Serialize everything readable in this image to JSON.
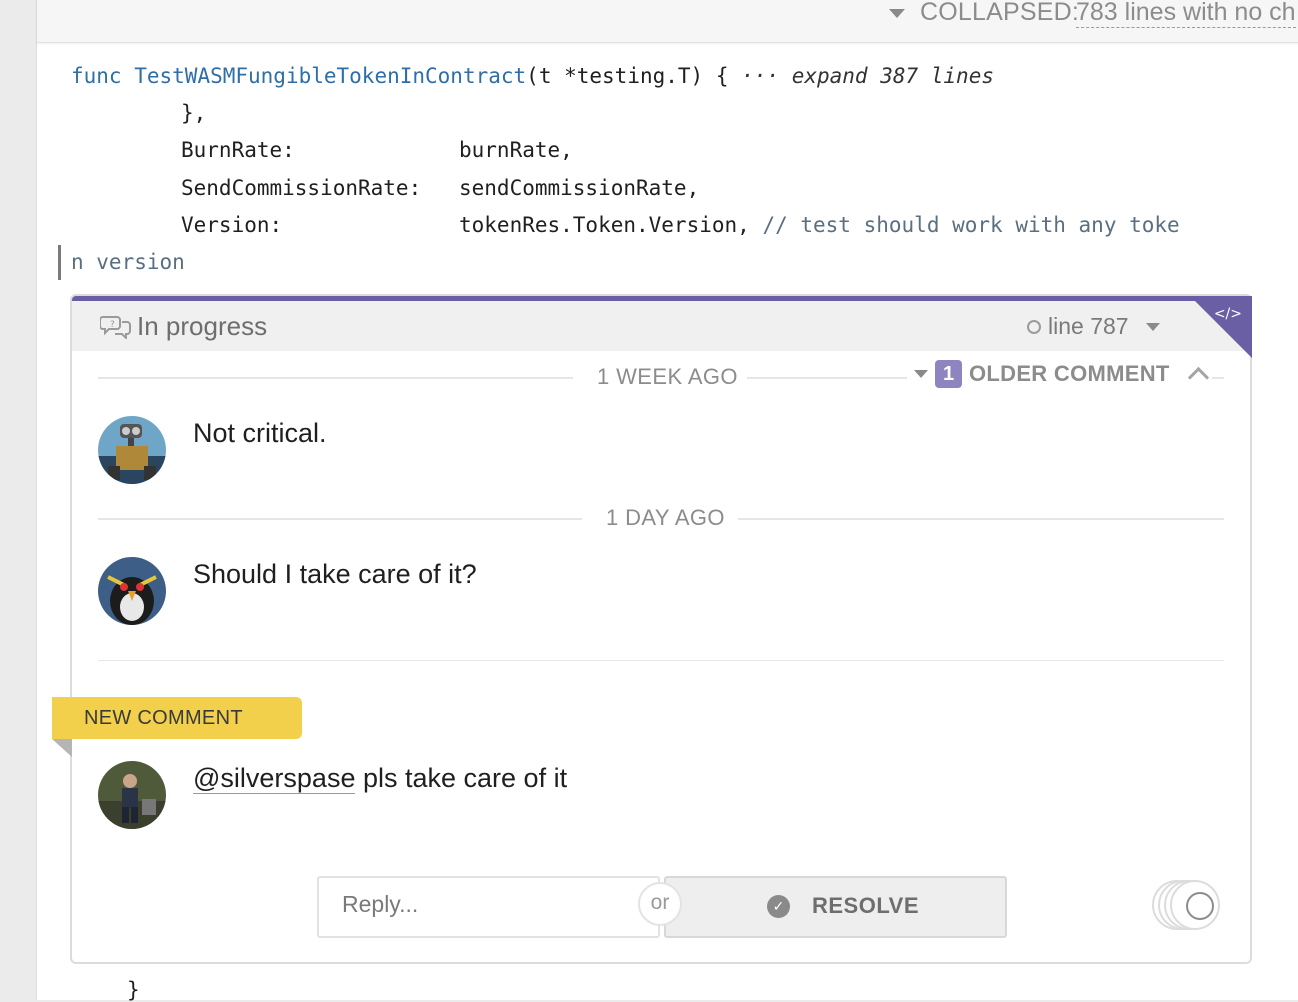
{
  "collapsed": {
    "label": "COLLAPSED:",
    "lines_text": "783 lines with no ch"
  },
  "code": {
    "line1_kw": "func",
    "line1_fn": "TestWASMFungibleTokenInContract",
    "line1_sig": "(t *testing.T) {",
    "line1_expand": "··· expand 387 lines",
    "line2": "},",
    "line3_key": "BurnRate:",
    "line3_val": "burnRate,",
    "line4_key": "SendCommissionRate:",
    "line4_val": "sendCommissionRate,",
    "line5_key": "Version:",
    "line5_val": "tokenRes.Token.Version,",
    "line5_comment": "// test should work with any toke",
    "line6": "n version",
    "closing": "}"
  },
  "thread": {
    "status": "In progress",
    "line_ref": "line 787",
    "older_count": "1",
    "older_label": "OLDER COMMENT",
    "new_label": "NEW COMMENT",
    "comments": [
      {
        "date": "1 WEEK AGO",
        "text": "Not critical."
      },
      {
        "date": "1 DAY AGO",
        "text": "Should I take care of it?"
      },
      {
        "mention": "@silverspase",
        "text": " pls take care of it"
      }
    ],
    "reply_placeholder": "Reply...",
    "or": "or",
    "resolve_label": "RESOLVE"
  },
  "colors": {
    "accent": "#6a5fa4",
    "new_flag": "#f2d04b",
    "badge": "#8e84bf"
  }
}
